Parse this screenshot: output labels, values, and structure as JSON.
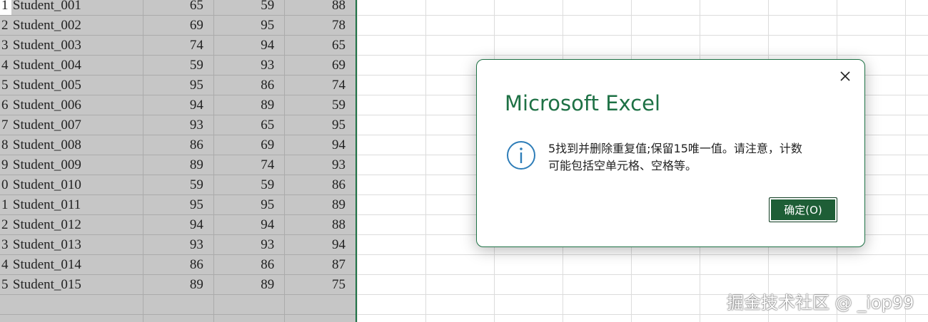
{
  "sheet": {
    "rows": [
      {
        "idx": "1",
        "name": "Student_001",
        "v1": "65",
        "v2": "59",
        "v3": "88"
      },
      {
        "idx": "2",
        "name": "Student_002",
        "v1": "69",
        "v2": "95",
        "v3": "78"
      },
      {
        "idx": "3",
        "name": "Student_003",
        "v1": "74",
        "v2": "94",
        "v3": "65"
      },
      {
        "idx": "4",
        "name": "Student_004",
        "v1": "59",
        "v2": "93",
        "v3": "69"
      },
      {
        "idx": "5",
        "name": "Student_005",
        "v1": "95",
        "v2": "86",
        "v3": "74"
      },
      {
        "idx": "6",
        "name": "Student_006",
        "v1": "94",
        "v2": "89",
        "v3": "59"
      },
      {
        "idx": "7",
        "name": "Student_007",
        "v1": "93",
        "v2": "65",
        "v3": "95"
      },
      {
        "idx": "8",
        "name": "Student_008",
        "v1": "86",
        "v2": "69",
        "v3": "94"
      },
      {
        "idx": "9",
        "name": "Student_009",
        "v1": "89",
        "v2": "74",
        "v3": "93"
      },
      {
        "idx": "0",
        "name": "Student_010",
        "v1": "59",
        "v2": "59",
        "v3": "86"
      },
      {
        "idx": "1",
        "name": "Student_011",
        "v1": "95",
        "v2": "95",
        "v3": "89"
      },
      {
        "idx": "2",
        "name": "Student_012",
        "v1": "94",
        "v2": "94",
        "v3": "88"
      },
      {
        "idx": "3",
        "name": "Student_013",
        "v1": "93",
        "v2": "93",
        "v3": "94"
      },
      {
        "idx": "4",
        "name": "Student_014",
        "v1": "86",
        "v2": "86",
        "v3": "87"
      },
      {
        "idx": "5",
        "name": "Student_015",
        "v1": "89",
        "v2": "89",
        "v3": "75"
      },
      {
        "idx": "",
        "name": "",
        "v1": "",
        "v2": "",
        "v3": ""
      },
      {
        "idx": "",
        "name": "",
        "v1": "",
        "v2": "",
        "v3": ""
      }
    ]
  },
  "dialog": {
    "title": "Microsoft Excel",
    "message_line1": "5找到并删除重复值;保留15唯一值。请注意，计数",
    "message_line2": "可能包括空单元格、空格等。",
    "ok_label": "确定(O)",
    "icon": "info-icon",
    "close_icon": "close-icon"
  },
  "watermark": {
    "text": "掘金技术社区 @ _iop99"
  },
  "colors": {
    "accent": "#1e7145",
    "selection": "#c6c6c6",
    "button_bg": "#1e5e36"
  }
}
